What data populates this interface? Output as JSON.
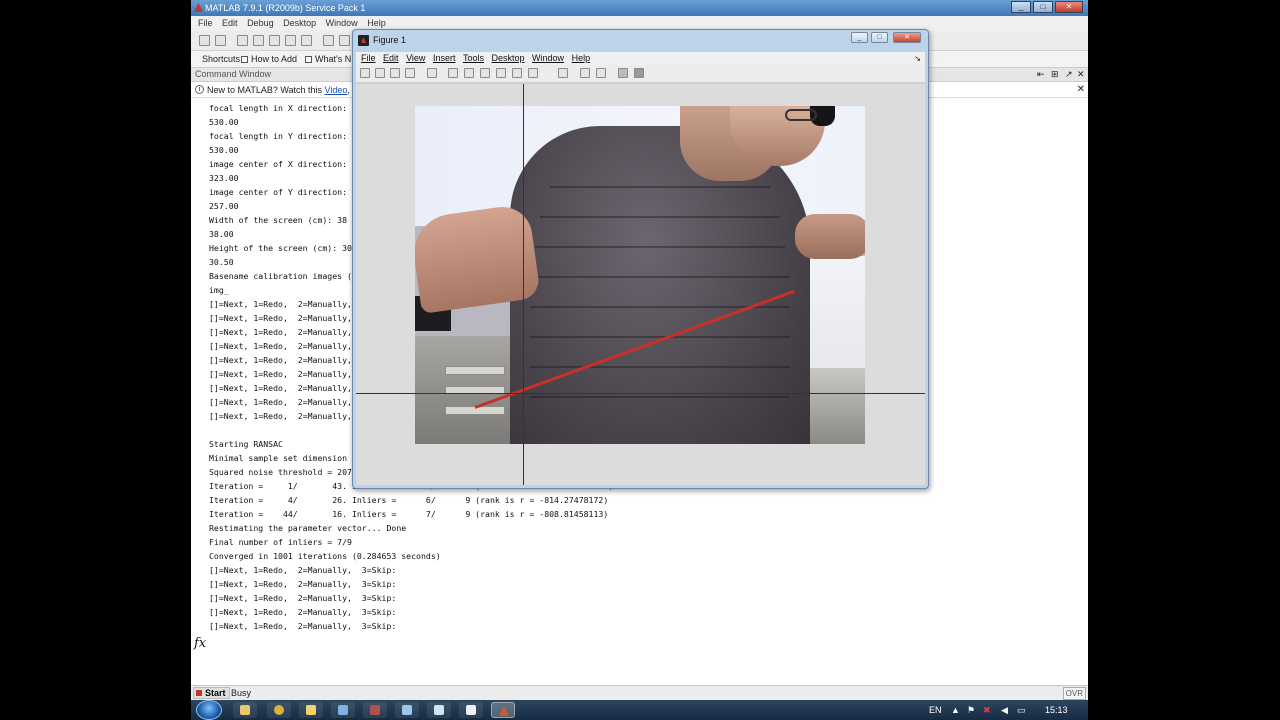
{
  "matlab": {
    "title": "MATLAB  7.9.1 (R2009b) Service Pack 1",
    "menu": [
      "File",
      "Edit",
      "Debug",
      "Desktop",
      "Window",
      "Help"
    ],
    "shortcuts": {
      "label": "Shortcuts",
      "how_to_add": "How to Add",
      "whats_new": "What's N"
    },
    "command_window_title": "Command Window",
    "info_bar": {
      "prefix": "New to MATLAB? Watch this ",
      "link": "Video",
      "suffix": ", se"
    }
  },
  "console_lines": [
    "focal length in X direction: ",
    "530.00",
    "focal length in Y direction: ",
    "530.00",
    "image center of X direction: ",
    "323.00",
    "image center of Y direction: ",
    "257.00",
    "Width of the screen (cm): 38",
    "38.00",
    "Height of the screen (cm): 30",
    "30.50",
    "Basename calibration images (",
    "img_",
    "[]=Next, 1=Redo,  2=Manually,",
    "[]=Next, 1=Redo,  2=Manually,",
    "[]=Next, 1=Redo,  2=Manually,",
    "[]=Next, 1=Redo,  2=Manually,",
    "[]=Next, 1=Redo,  2=Manually,",
    "[]=Next, 1=Redo,  2=Manually,",
    "[]=Next, 1=Redo,  2=Manually,",
    "[]=Next, 1=Redo,  2=Manually,",
    "[]=Next, 1=Redo,  2=Manually,",
    "",
    "Starting RANSAC",
    "Minimal sample set dimension",
    "Squared noise threshold = 207",
    "Iteration =     1/       43. Inliers =      5/      9 (rank is r = -1241.79360757)",
    "Iteration =     4/       26. Inliers =      6/      9 (rank is r = -814.27478172)",
    "Iteration =    44/       16. Inliers =      7/      9 (rank is r = -808.81458113)",
    "Restimating the parameter vector... Done",
    "Final number of inliers = 7/9",
    "Converged in 1001 iterations (0.284653 seconds)",
    "[]=Next, 1=Redo,  2=Manually,  3=Skip:",
    "[]=Next, 1=Redo,  2=Manually,  3=Skip:",
    "[]=Next, 1=Redo,  2=Manually,  3=Skip:",
    "[]=Next, 1=Redo,  2=Manually,  3=Skip:",
    "[]=Next, 1=Redo,  2=Manually,  3=Skip:"
  ],
  "prompt_symbol": "fx",
  "status": {
    "start": "Start",
    "busy": "Busy",
    "ovr": "OVR"
  },
  "figure": {
    "title": "Figure 1",
    "menu": [
      "File",
      "Edit",
      "View",
      "Insert",
      "Tools",
      "Desktop",
      "Window",
      "Help"
    ]
  },
  "taskbar": {
    "lang": "EN",
    "clock": "15:13"
  },
  "icons": {
    "matlab_logo": "matlab-logo-icon",
    "figure_logo": "figure-logo-icon",
    "start_orb": "windows-start-icon"
  },
  "colors": {
    "titlebar": "#3f77b7",
    "laser": "#c9302a",
    "link": "#1a4fb5"
  }
}
